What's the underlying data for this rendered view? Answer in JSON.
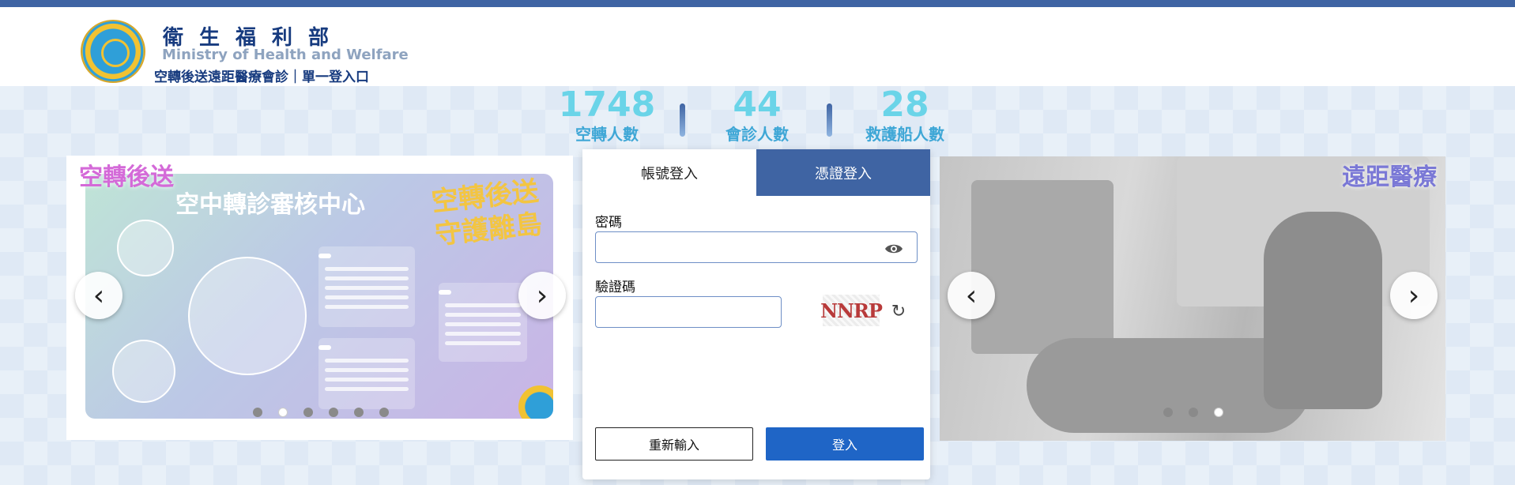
{
  "header": {
    "org_name_zh": "衛生福利部",
    "org_name_en": "Ministry of Health and Welfare",
    "portal_title": "空轉後送遠距醫療會診｜單一登入口"
  },
  "stats": [
    {
      "value": "1748",
      "label": "空轉人數"
    },
    {
      "value": "44",
      "label": "會診人數"
    },
    {
      "value": "28",
      "label": "救護船人數"
    }
  ],
  "left_carousel": {
    "tag": "空轉後送",
    "poster_title": "空中轉診審核中心",
    "poster_slogan_line1": "空轉後送",
    "poster_slogan_line2": "守護離島",
    "slide_count": 6,
    "active_slide": 2
  },
  "right_carousel": {
    "tag": "遠距醫療",
    "slide_count": 3,
    "active_slide": 3
  },
  "login": {
    "tab_account": "帳號登入",
    "tab_certificate": "憑證登入",
    "active_tab": "憑證登入",
    "password_label": "密碼",
    "password_value": "",
    "captcha_label": "驗證碼",
    "captcha_value": "",
    "captcha_image_text": "NNRP",
    "reset_button": "重新輸入",
    "submit_button": "登入"
  },
  "colors": {
    "brand_blue": "#3f64a3",
    "submit_blue": "#1f65c6",
    "stat_cyan": "#6ad4e8",
    "tag_pink": "#d46ad8",
    "tag_purple": "#7a78d6"
  },
  "icons": {
    "prev": "chevron-left-icon",
    "next": "chevron-right-icon",
    "show_password": "eye-icon",
    "refresh_captcha": "refresh-icon"
  }
}
